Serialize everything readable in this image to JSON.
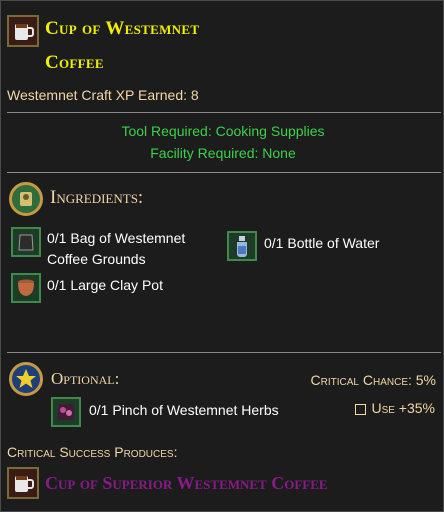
{
  "item": {
    "title_line1": "Cup of Westemnet",
    "title_line2": "Coffee",
    "craft_xp": "Westemnet Craft XP Earned: 8",
    "tool_required": "Tool Required: Cooking Supplies",
    "facility_required": "Facility Required: None"
  },
  "ingredients": {
    "title": "Ingredients:",
    "items": [
      {
        "line1": "0/1 Bag of Westemnet",
        "line2": "Coffee Grounds",
        "icon": "coffee-grounds-bag-icon"
      },
      {
        "line1": "0/1 Bottle of Water",
        "line2": "",
        "icon": "water-bottle-icon"
      },
      {
        "line1": "0/1 Large Clay Pot",
        "line2": "",
        "icon": "clay-pot-icon"
      }
    ]
  },
  "optional": {
    "title": "Optional:",
    "critical_chance": "Critical Chance: 5%",
    "item": "0/1 Pinch of Westemnet Herbs",
    "use_label": "Use +35%"
  },
  "critical": {
    "label": "Critical Success Produces:",
    "result": "Cup of Superior Westemnet Coffee"
  },
  "colors": {
    "title_yellow": "#f2f000",
    "tan": "#f0d7a6",
    "green": "#3bd14a",
    "purple": "#8a1a8a"
  }
}
